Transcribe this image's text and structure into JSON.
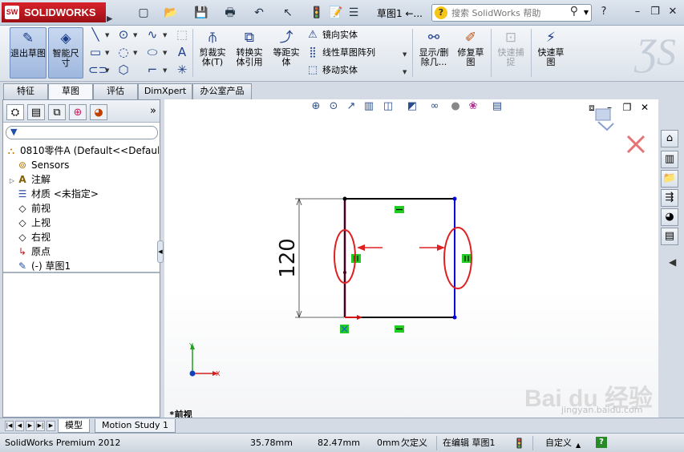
{
  "app": {
    "brand": "SOLIDWORKS",
    "document_title": "草图1 ←...",
    "search_placeholder": "搜索 SolidWorks 帮助"
  },
  "command_manager": {
    "exit_sketch": "退出草图",
    "smart_dimension": "智能尺寸",
    "trim": "剪裁实体",
    "trim_sub": "(T)",
    "convert": "转换实体引用",
    "offset": "等距实体",
    "mirror": "镜向实体",
    "linear_pattern": "线性草图阵列",
    "move": "移动实体",
    "show_delete": "显示/删除几...",
    "repair": "修复草图",
    "quick_snap": "快速捕捉",
    "rapid_sketch": "快速草图"
  },
  "tabs": [
    "特征",
    "草图",
    "评估",
    "DimXpert",
    "办公室产品"
  ],
  "active_tab": "草图",
  "tree": {
    "root": "0810零件A  (Default<<Default",
    "items": [
      {
        "label": "Sensors",
        "icon": "sensor-icon"
      },
      {
        "label": "注解",
        "icon": "annotation-icon",
        "expandable": true
      },
      {
        "label": "材质 <未指定>",
        "icon": "material-icon"
      },
      {
        "label": "前视",
        "icon": "plane-icon"
      },
      {
        "label": "上视",
        "icon": "plane-icon"
      },
      {
        "label": "右视",
        "icon": "plane-icon"
      },
      {
        "label": "原点",
        "icon": "origin-icon"
      },
      {
        "label": "(-) 草图1",
        "icon": "sketch-icon"
      }
    ]
  },
  "graphics": {
    "view_label": "*前视",
    "dimension_value": "120",
    "axis_x": "X",
    "axis_y": "Y"
  },
  "bottom_tabs": [
    "模型",
    "Motion Study 1"
  ],
  "status": {
    "product": "SolidWorks Premium 2012",
    "x": "35.78mm",
    "y": "82.47mm",
    "z": "0mm",
    "definition": "欠定义",
    "mode": "在编辑 草图1",
    "custom": "自定义"
  },
  "watermark": {
    "text": "Bai du 经验",
    "sub": "jingyan.baidu.com"
  },
  "colors": {
    "accent_blue": "#1b3d8a",
    "sketch_blue": "#0000e0",
    "highlight_red": "#e02020",
    "relation_green": "#22cc22"
  }
}
